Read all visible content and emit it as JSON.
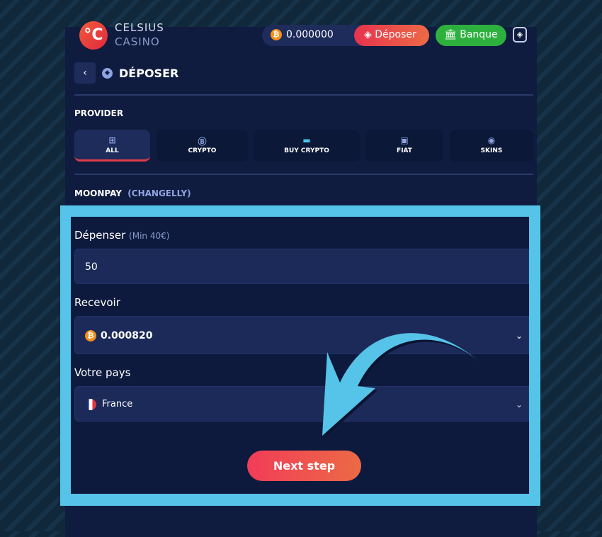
{
  "header": {
    "logo_line1": "CELSIUS",
    "logo_line2": "CASINO",
    "balance": "0.000000",
    "deposit_label": "Déposer",
    "bank_label": "Banque"
  },
  "page": {
    "title": "DÉPOSER",
    "provider_label": "PROVIDER",
    "provider_name": "MOONPAY",
    "provider_sub": "(CHANGELLY)"
  },
  "tabs": [
    {
      "label": "ALL",
      "icon": "grid-icon"
    },
    {
      "label": "CRYPTO",
      "icon": "bitcoin-icon"
    },
    {
      "label": "BUY CRYPTO",
      "icon": "card-icon"
    },
    {
      "label": "FIAT",
      "icon": "wallet-icon"
    },
    {
      "label": "SKINS",
      "icon": "steam-icon"
    }
  ],
  "form": {
    "spend_label": "Dépenser",
    "spend_min": "(Min 40€)",
    "spend_value": "50",
    "receive_label": "Recevoir",
    "receive_value": "0.000820",
    "country_label": "Votre pays",
    "country_value": "France",
    "next_label": "Next step"
  },
  "colors": {
    "highlight": "#56c3e8",
    "accent": "#e7334e",
    "bank": "#2eb03e"
  }
}
